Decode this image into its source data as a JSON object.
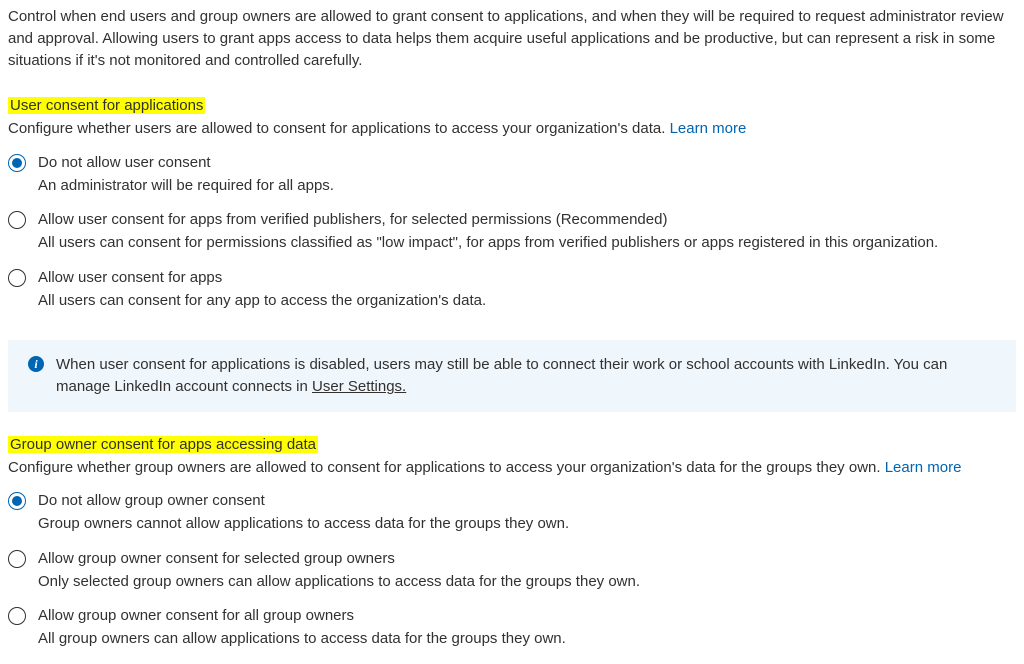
{
  "intro": "Control when end users and group owners are allowed to grant consent to applications, and when they will be required to request administrator review and approval. Allowing users to grant apps access to data helps them acquire useful applications and be productive, but can represent a risk in some situations if it's not monitored and controlled carefully.",
  "section1": {
    "heading": "User consent for applications",
    "subtext": "Configure whether users are allowed to consent for applications to access your organization's data. ",
    "learn_more": "Learn more",
    "options": [
      {
        "label": "Do not allow user consent",
        "desc": "An administrator will be required for all apps.",
        "checked": true
      },
      {
        "label": "Allow user consent for apps from verified publishers, for selected permissions (Recommended)",
        "desc": "All users can consent for permissions classified as \"low impact\", for apps from verified publishers or apps registered in this organization.",
        "checked": false
      },
      {
        "label": "Allow user consent for apps",
        "desc": "All users can consent for any app to access the organization's data.",
        "checked": false
      }
    ]
  },
  "info": {
    "text_before": "When user consent for applications is disabled, users may still be able to connect their work or school accounts with LinkedIn. You can manage LinkedIn account connects in ",
    "link": "User Settings.",
    "text_after": ""
  },
  "section2": {
    "heading": "Group owner consent for apps accessing data",
    "subtext": "Configure whether group owners are allowed to consent for applications to access your organization's data for the groups they own. ",
    "learn_more": "Learn more",
    "options": [
      {
        "label": "Do not allow group owner consent",
        "desc": "Group owners cannot allow applications to access data for the groups they own.",
        "checked": true
      },
      {
        "label": "Allow group owner consent for selected group owners",
        "desc": "Only selected group owners can allow applications to access data for the groups they own.",
        "checked": false
      },
      {
        "label": "Allow group owner consent for all group owners",
        "desc": "All group owners can allow applications to access data for the groups they own.",
        "checked": false
      }
    ]
  }
}
